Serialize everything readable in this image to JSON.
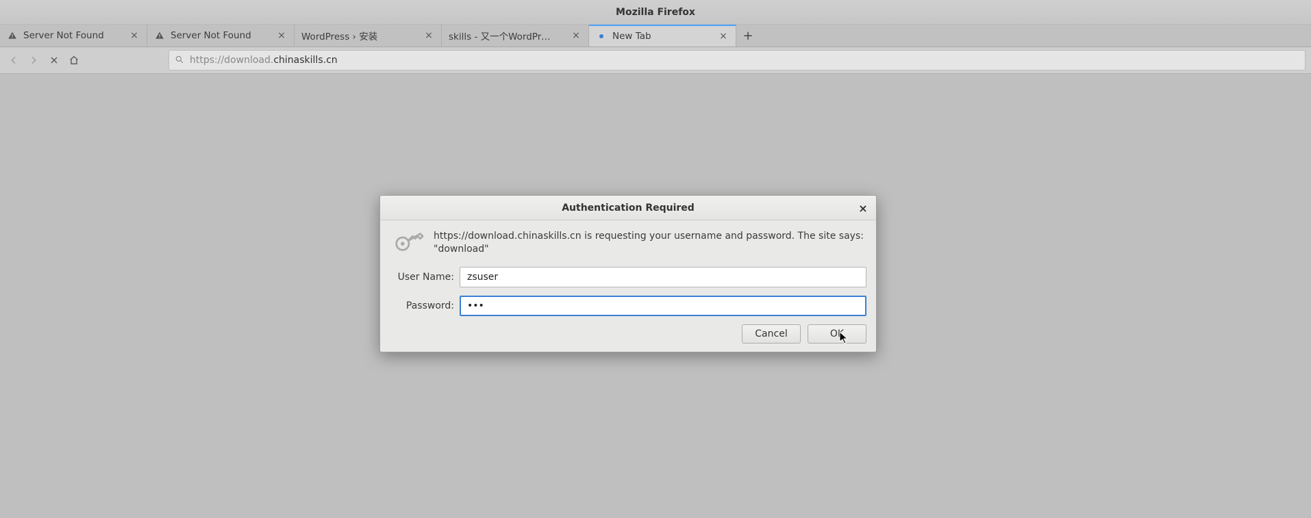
{
  "window": {
    "title": "Mozilla Firefox"
  },
  "tabs": [
    {
      "label": "Server Not Found",
      "icon": "warning"
    },
    {
      "label": "Server Not Found",
      "icon": "warning"
    },
    {
      "label": "WordPress › 安装",
      "icon": "none"
    },
    {
      "label": "skills - 又一个WordPress站",
      "icon": "none"
    },
    {
      "label": "New Tab",
      "icon": "loading",
      "active": true
    }
  ],
  "url": {
    "prefix": "https://download.",
    "domain": "chinaskills.cn"
  },
  "dialog": {
    "title": "Authentication Required",
    "message": "https://download.chinaskills.cn is requesting your username and password. The site says: \"download\"",
    "user_label": "User Name:",
    "pass_label": "Password:",
    "user_value": "zsuser",
    "pass_value": "•••",
    "cancel": "Cancel",
    "ok": "OK"
  }
}
